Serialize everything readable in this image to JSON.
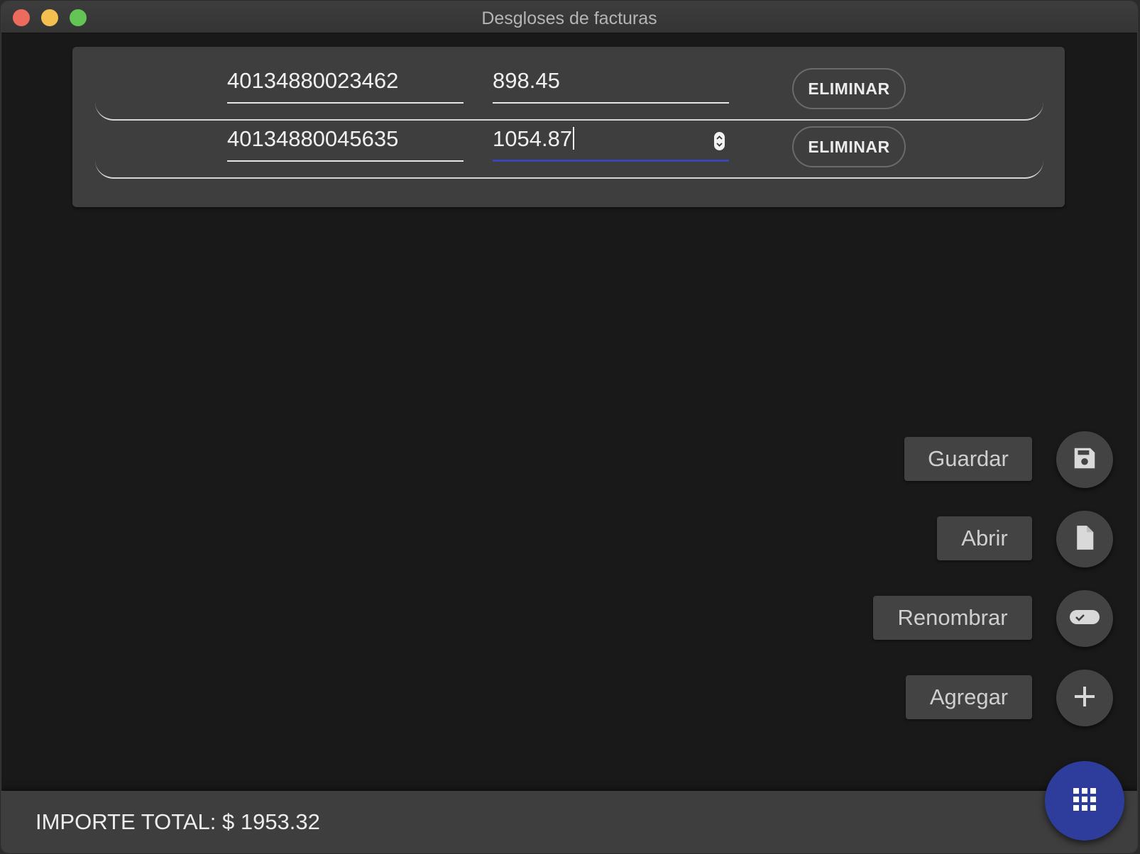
{
  "window": {
    "title": "Desgloses de facturas"
  },
  "rows": [
    {
      "code": "40134880023462",
      "amount": "898.45",
      "delete_label": "ELIMINAR"
    },
    {
      "code": "40134880045635",
      "amount": "1054.87",
      "delete_label": "ELIMINAR"
    }
  ],
  "actions": {
    "save": {
      "label": "Guardar",
      "icon": "save-icon"
    },
    "open": {
      "label": "Abrir",
      "icon": "file-icon"
    },
    "rename": {
      "label": "Renombrar",
      "icon": "rename-icon"
    },
    "add": {
      "label": "Agregar",
      "icon": "plus-icon"
    }
  },
  "footer": {
    "total_text": "IMPORTE TOTAL: $ 1953.32"
  },
  "main_fab": {
    "icon": "grid-icon"
  },
  "colors": {
    "accent": "#2e3c9c",
    "focus_underline": "#3a45b8"
  }
}
